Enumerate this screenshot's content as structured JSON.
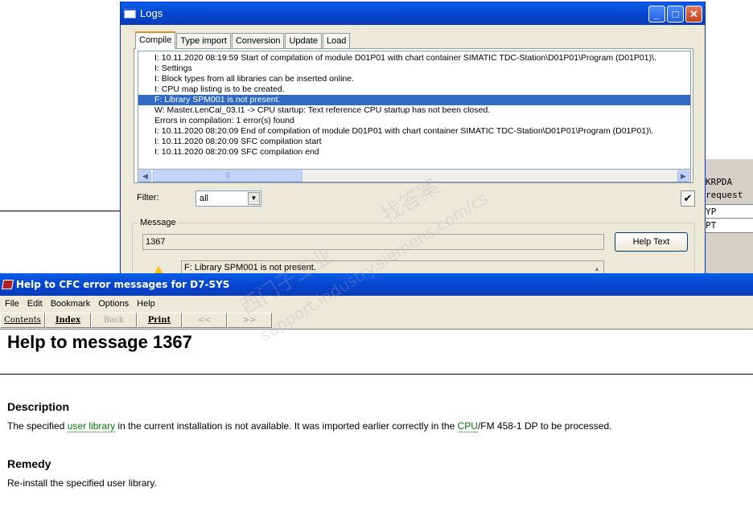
{
  "background_window": {
    "rows": [
      "KRPDA",
      "request",
      "YP",
      "PT"
    ]
  },
  "logs_window": {
    "title": "Logs",
    "tabs": [
      "Compile",
      "Type import",
      "Conversion",
      "Update",
      "Load"
    ],
    "active_tab": "Compile",
    "log_lines": [
      "I: 10.11.2020  08:19:59 Start of compilation of module D01P01 with chart container SIMATIC TDC-Station\\D01P01\\Program (D01P01)\\.",
      "I: Settings",
      "I: Block types from all libraries can be inserted online.",
      "I: CPU map listing is to be created.",
      "F: Library SPM001 is not present.",
      "W: Master.LenCal_03.I1 -> CPU startup: Text reference CPU startup has not been closed.",
      "Errors in compilation: 1 error(s) found",
      "I: 10.11.2020  08:20:09 End of compilation of module D01P01 with chart container SIMATIC TDC-Station\\D01P01\\Program (D01P01)\\.",
      "I: 10.11.2020  08:20:09 SFC compilation start",
      "I: 10.11.2020  08:20:09 SFC compilation end"
    ],
    "selected_index": 4,
    "filter_label": "Filter:",
    "filter_value": "all",
    "message_group_label": "Message",
    "message_number": "1367",
    "help_text_button": "Help Text",
    "message_text": "F: Library SPM001 is not present.",
    "check_glyph": "✔"
  },
  "help_window": {
    "title": "Help to CFC error messages for D7-SYS",
    "menu": [
      "File",
      "Edit",
      "Bookmark",
      "Options",
      "Help"
    ],
    "toolbar": {
      "contents": "Contents",
      "index": "Index",
      "back": "Back",
      "print": "Print",
      "prev": "<<",
      "next": ">>"
    },
    "heading": "Help to message 1367",
    "description_heading": "Description",
    "description": {
      "part1": "The specified ",
      "link1": "user library",
      "part2": " in the current installation is not available. It was imported earlier correctly in the ",
      "link2": "CPU",
      "part3": "/FM 458-1 DP to be processed."
    },
    "remedy_heading": "Remedy",
    "remedy_text": "Re-install the specified user library."
  },
  "watermark": {
    "line1": "找答案",
    "line2": "support.industry.siemens.com/cs",
    "line3": "西门子工业"
  },
  "colors": {
    "titlebar": "#0746d0",
    "selection": "#316ac5",
    "link": "#007a00"
  }
}
